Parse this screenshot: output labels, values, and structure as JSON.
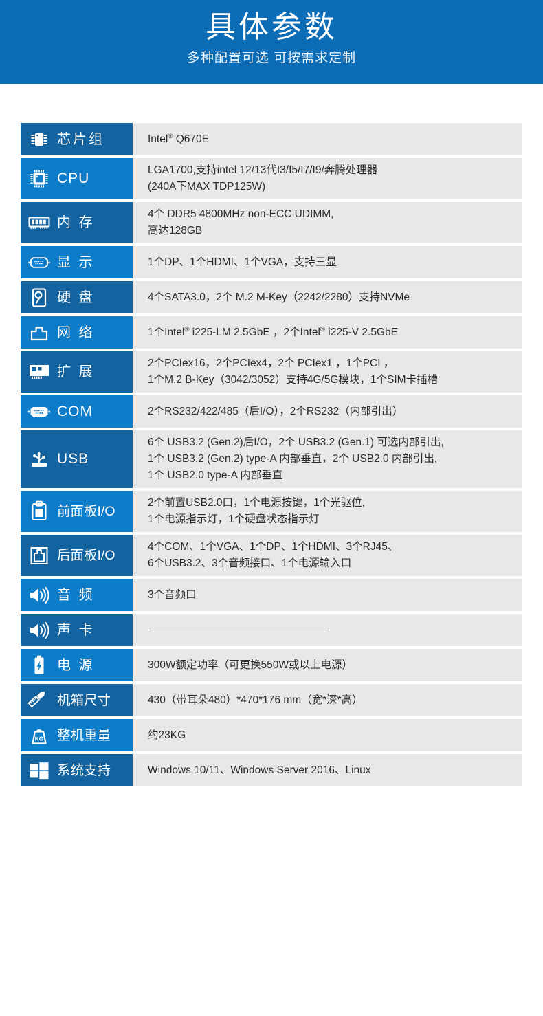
{
  "banner": {
    "title": "具体参数",
    "subtitle": "多种配置可选 可按需求定制"
  },
  "table": {
    "rows": [
      {
        "icon": "chip-icon",
        "label": "芯片组",
        "shade": "dark",
        "lines": [
          "Intel® Q670E"
        ]
      },
      {
        "icon": "cpu-icon",
        "label": "CPU",
        "shade": "light",
        "lines": [
          "LGA1700,支持intel 12/13代I3/I5/I7/I9/奔腾处理器",
          "(240A下MAX TDP125W)"
        ]
      },
      {
        "icon": "memory-module-icon",
        "label": "内 存",
        "shade": "dark",
        "lines": [
          "4个 DDR5 4800MHz non-ECC UDIMM,",
          "高达128GB"
        ]
      },
      {
        "icon": "vga-port-icon",
        "label": "显 示",
        "shade": "light",
        "lines": [
          "1个DP、1个HDMI、1个VGA，支持三显"
        ]
      },
      {
        "icon": "hard-disk-icon",
        "label": "硬 盘",
        "shade": "dark",
        "lines": [
          "4个SATA3.0，2个 M.2 M-Key（2242/2280）支持NVMe"
        ]
      },
      {
        "icon": "rj45-network-icon",
        "label": "网 络",
        "shade": "light",
        "lines": [
          "1个Intel® i225-LM 2.5GbE ，2个Intel® i225-V 2.5GbE"
        ]
      },
      {
        "icon": "expansion-card-icon",
        "label": "扩 展",
        "shade": "dark",
        "lines": [
          "2个PCIex16，2个PCIex4，2个 PCIex1 ，1个PCI ，",
          "1个M.2 B-Key（3042/3052）支持4G/5G模块，1个SIM卡插槽"
        ]
      },
      {
        "icon": "serial-port-icon",
        "label": "COM",
        "shade": "light",
        "lines": [
          "2个RS232/422/485（后I/O），2个RS232（内部引出）"
        ]
      },
      {
        "icon": "usb-icon",
        "label": "USB",
        "shade": "dark",
        "lines": [
          "6个 USB3.2 (Gen.2)后I/O，2个 USB3.2 (Gen.1) 可选内部引出,",
          "1个 USB3.2 (Gen.2) type-A 内部垂直，2个 USB2.0 内部引出,",
          "1个 USB2.0 type-A 内部垂直"
        ]
      },
      {
        "icon": "front-panel-icon",
        "label": "前面板I/O",
        "shade": "light",
        "lines": [
          "2个前置USB2.0口，1个电源按键，1个光驱位,",
          "1个电源指示灯，1个硬盘状态指示灯"
        ]
      },
      {
        "icon": "rear-panel-icon",
        "label": "后面板I/O",
        "shade": "dark",
        "lines": [
          "4个COM、1个VGA、1个DP、1个HDMI、3个RJ45、",
          "6个USB3.2、3个音频接口、1个电源输入口"
        ]
      },
      {
        "icon": "speaker-icon",
        "label": "音 频",
        "shade": "light",
        "lines": [
          "3个音频口"
        ]
      },
      {
        "icon": "speaker-icon",
        "label": "声 卡",
        "shade": "dark",
        "lines": [
          ""
        ]
      },
      {
        "icon": "battery-power-icon",
        "label": "电 源",
        "shade": "light",
        "lines": [
          "300W额定功率（可更换550W或以上电源）"
        ]
      },
      {
        "icon": "ruler-pencil-icon",
        "label": "机箱尺寸",
        "shade": "dark",
        "lines": [
          "430（带耳朵480）*470*176 mm（宽*深*高）"
        ]
      },
      {
        "icon": "weight-kg-icon",
        "label": "整机重量",
        "shade": "light",
        "lines": [
          "约23KG"
        ]
      },
      {
        "icon": "windows-logo-icon",
        "label": "系统支持",
        "shade": "dark",
        "lines": [
          "Windows 10/11、Windows Server 2016、Linux"
        ]
      }
    ]
  },
  "colors": {
    "banner_blue": "#0c6cb5",
    "label_dark_blue": "#12639f",
    "label_light_blue": "#0d7cc9",
    "value_gray": "#e8e8e8",
    "value_text": "#2b2b2b"
  }
}
